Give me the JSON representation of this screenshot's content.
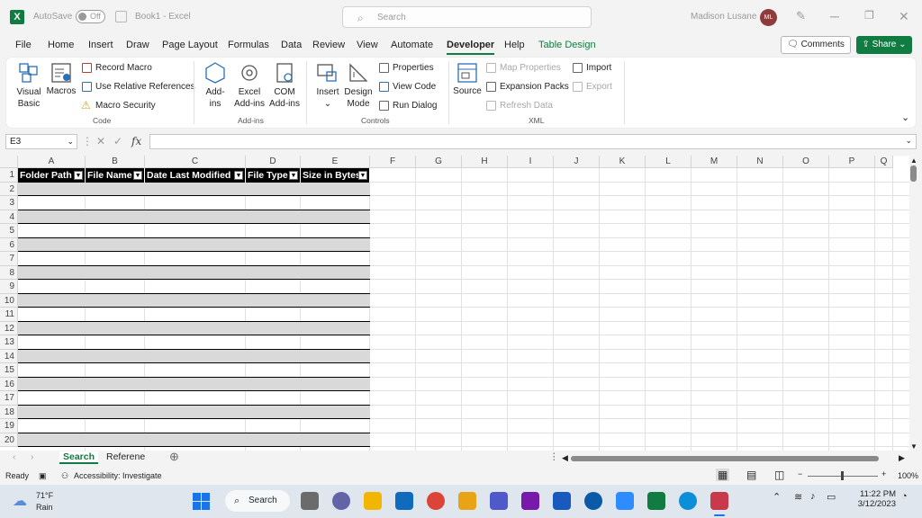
{
  "titlebar": {
    "autosave_label": "AutoSave",
    "autosave_state": "Off",
    "doc_title": "Book1 - Excel",
    "search_placeholder": "Search",
    "user_name": "Madison Lusane",
    "user_initials": "ML"
  },
  "menu": {
    "tabs": [
      "File",
      "Home",
      "Insert",
      "Draw",
      "Page Layout",
      "Formulas",
      "Data",
      "Review",
      "View",
      "Automate",
      "Developer",
      "Help",
      "Table Design"
    ],
    "active": "Developer",
    "comments_label": "Comments",
    "share_label": "Share"
  },
  "ribbon": {
    "code": {
      "label": "Code",
      "visual_basic": [
        "Visual",
        "Basic"
      ],
      "macros": "Macros",
      "record_macro": "Record Macro",
      "relative_refs": "Use Relative References",
      "macro_security": "Macro Security"
    },
    "addins": {
      "label": "Add-ins",
      "addins": [
        "Add-",
        "ins"
      ],
      "excel_addins": [
        "Excel",
        "Add-ins"
      ],
      "com_addins": [
        "COM",
        "Add-ins"
      ]
    },
    "controls": {
      "label": "Controls",
      "insert": "Insert",
      "design_mode": [
        "Design",
        "Mode"
      ],
      "properties": "Properties",
      "view_code": "View Code",
      "run_dialog": "Run Dialog"
    },
    "xml": {
      "label": "XML",
      "source": "Source",
      "map_properties": "Map Properties",
      "expansion_packs": "Expansion Packs",
      "refresh_data": "Refresh Data",
      "import": "Import",
      "export": "Export"
    }
  },
  "formula_bar": {
    "name_box": "E3",
    "cancel_glyph": "✕",
    "enter_glyph": "✓",
    "fx_glyph": "fx",
    "value": ""
  },
  "grid": {
    "columns": [
      "A",
      "B",
      "C",
      "D",
      "E",
      "F",
      "G",
      "H",
      "I",
      "J",
      "K",
      "L",
      "M",
      "N",
      "O",
      "P",
      "Q"
    ],
    "rows": [
      "1",
      "2",
      "3",
      "4",
      "5",
      "6",
      "7",
      "8",
      "9",
      "10",
      "11",
      "12",
      "13",
      "14",
      "15",
      "16",
      "17",
      "18",
      "19",
      "20"
    ],
    "table_headers": [
      "Folder Path",
      "File Name",
      "Date Last Modified",
      "File Type",
      "Size in Bytes"
    ]
  },
  "sheets": {
    "tabs": [
      "Search",
      "Referene"
    ],
    "active": "Search"
  },
  "status": {
    "ready": "Ready",
    "accessibility": "Accessibility: Investigate",
    "zoom": "100%"
  },
  "taskbar": {
    "weather_temp": "71°F",
    "weather_desc": "Rain",
    "search_label": "Search",
    "time": "11:22 PM",
    "date": "3/12/2023"
  },
  "colors": {
    "accent": "#107c41",
    "table_header": "#000000",
    "table_band": "#d9d9d9"
  }
}
